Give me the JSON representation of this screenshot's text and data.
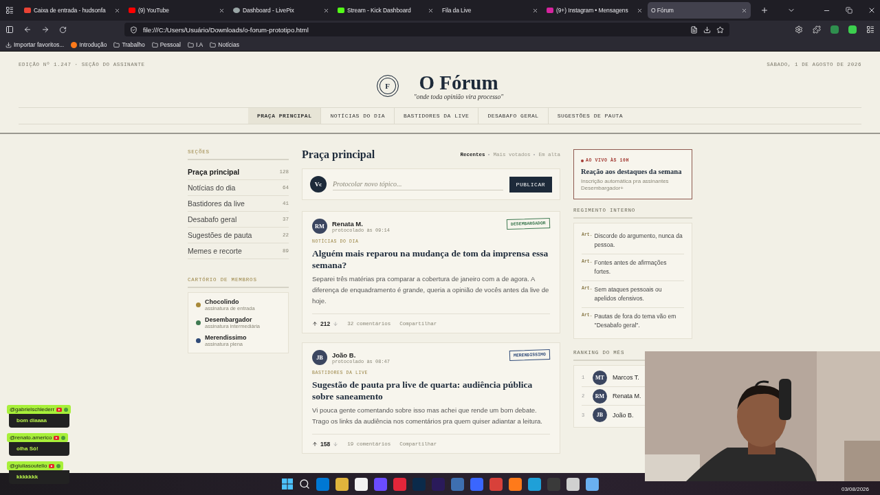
{
  "browser": {
    "tabs": [
      {
        "title": "Caixa de entrada - hudsonfa",
        "selected": false
      },
      {
        "title": "(9) YouTube",
        "selected": false
      },
      {
        "title": "Dashboard - LivePix",
        "selected": false
      },
      {
        "title": "Stream - Kick Dashboard",
        "selected": false
      },
      {
        "title": "Fila da Live",
        "selected": false
      },
      {
        "title": "(9+) Instagram • Mensagens",
        "selected": false
      },
      {
        "title": "O Fórum",
        "selected": true
      }
    ],
    "url": "file:///C:/Users/Usuário/Downloads/o-forum-prototipo.html",
    "bookmarks": [
      "Importar favoritos...",
      "Introdução",
      "Trabalho",
      "Pessoal",
      "I.A",
      "Notícias"
    ]
  },
  "masthead": {
    "edition": "EDIÇÃO Nº 1.247 · SEÇÃO DO ASSINANTE",
    "date": "SÁBADO, 1 DE AGOSTO DE 2026",
    "logo_letter": "F",
    "title": "O Fórum",
    "tagline": "\"onde toda opinião vira processo\""
  },
  "nav": [
    {
      "label": "PRAÇA PRINCIPAL",
      "selected": true
    },
    {
      "label": "NOTÍCIAS DO DIA",
      "selected": false
    },
    {
      "label": "BASTIDORES DA LIVE",
      "selected": false
    },
    {
      "label": "DESABAFO GERAL",
      "selected": false
    },
    {
      "label": "SUGESTÕES DE PAUTA",
      "selected": false
    }
  ],
  "sections": {
    "title": "SEÇÕES",
    "items": [
      {
        "label": "Praça principal",
        "count": "128",
        "selected": true
      },
      {
        "label": "Notícias do dia",
        "count": "64",
        "selected": false
      },
      {
        "label": "Bastidores da live",
        "count": "41",
        "selected": false
      },
      {
        "label": "Desabafo geral",
        "count": "37",
        "selected": false
      },
      {
        "label": "Sugestões de pauta",
        "count": "22",
        "selected": false
      },
      {
        "label": "Memes e recorte",
        "count": "89",
        "selected": false
      }
    ]
  },
  "members": {
    "title": "CARTÓRIO DE MEMBROS",
    "items": [
      {
        "name": "Chocolindo",
        "tier": "assinatura de entrada",
        "color": "#a8893a"
      },
      {
        "name": "Desembargador",
        "tier": "assinatura intermediária",
        "color": "#3f7a52"
      },
      {
        "name": "Merendissimo",
        "tier": "assinatura plena",
        "color": "#2f4a78"
      }
    ]
  },
  "feed": {
    "title": "Praça principal",
    "sorts": [
      {
        "label": "Recentes",
        "selected": true
      },
      {
        "label": "Mais votados",
        "selected": false
      },
      {
        "label": "Em alta",
        "selected": false
      }
    ],
    "composer": {
      "avatar": "Vc",
      "placeholder": "Protocolar novo tópico...",
      "button": "PUBLICAR"
    },
    "posts": [
      {
        "initials": "RM",
        "author": "Renata M.",
        "time": "protocolado às 09:14",
        "badge": "DESEMBARGADOR",
        "color": "#3f7a52",
        "category": "NOTÍCIAS DO DIA",
        "title": "Alguém mais reparou na mudança de tom da imprensa essa semana?",
        "body": "Separei três matérias pra comparar a cobertura de janeiro com a de agora. A diferença de enquadramento é grande, queria a opinião de vocês antes da live de hoje.",
        "score": "212",
        "comments": "32 comentários",
        "share": "Compartilhar"
      },
      {
        "initials": "JB",
        "author": "João B.",
        "time": "protocolado às 08:47",
        "badge": "MERENDISSIMO",
        "color": "#2f4a78",
        "category": "BASTIDORES DA LIVE",
        "title": "Sugestão de pauta pra live de quarta: audiência pública sobre saneamento",
        "body": "Vi pouca gente comentando sobre isso mas achei que rende um bom debate. Trago os links da audiência nos comentários pra quem quiser adiantar a leitura.",
        "score": "158",
        "comments": "19 comentários",
        "share": "Compartilhar"
      }
    ]
  },
  "live": {
    "label": "AO VIVO ÀS 10H",
    "title": "Reação aos destaques da semana",
    "subtitle": "Inscrição automática pra assinantes Desembargador+"
  },
  "rules": {
    "title": "REGIMENTO INTERNO",
    "items": [
      {
        "prefix": "Art.",
        "text": "Discorde do argumento, nunca da pessoa."
      },
      {
        "prefix": "Art.",
        "text": "Fontes antes de afirmações fortes."
      },
      {
        "prefix": "Art.",
        "text": "Sem ataques pessoais ou apelidos ofensivos."
      },
      {
        "prefix": "Art.",
        "text": "Pautas de fora do tema vão em \"Desabafo geral\"."
      }
    ]
  },
  "ranking": {
    "title": "RANKING DO MÊS",
    "items": [
      {
        "rank": "1",
        "initials": "MT",
        "name": "Marcos T."
      },
      {
        "rank": "2",
        "initials": "RM",
        "name": "Renata M."
      },
      {
        "rank": "3",
        "initials": "JB",
        "name": "João B."
      }
    ]
  },
  "chat": [
    {
      "user": "@gabrielschlederr",
      "message": "bom diaaaa"
    },
    {
      "user": "@renato.americo",
      "message": "olha Só!"
    },
    {
      "user": "@giuliasoutello",
      "message": "kkkkkkk"
    }
  ],
  "taskbar": {
    "date": "03/08/2026"
  }
}
